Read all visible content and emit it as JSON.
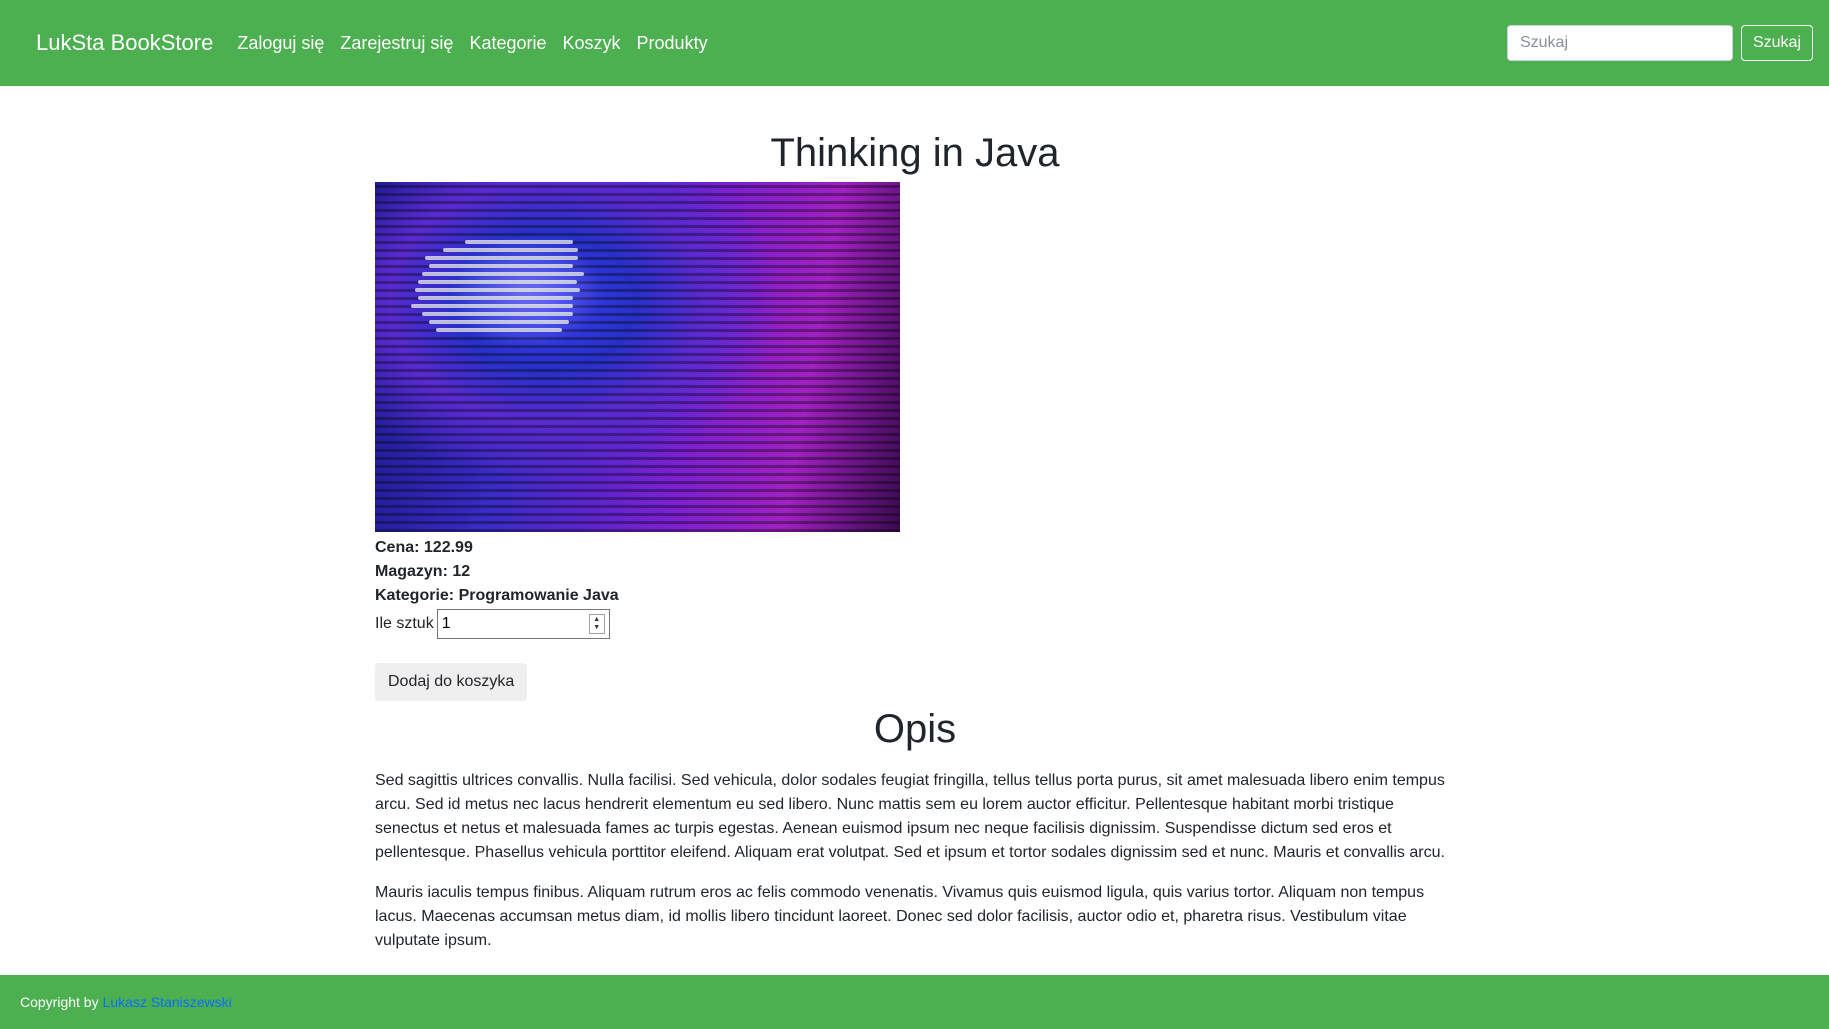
{
  "navbar": {
    "brand": "LukSta BookStore",
    "links": [
      "Zaloguj się",
      "Zarejestruj się",
      "Kategorie",
      "Koszyk",
      "Produkty"
    ],
    "search_placeholder": "Szukaj",
    "search_button": "Szukaj",
    "background_color": "#4caf50"
  },
  "product": {
    "title": "Thinking in Java",
    "price_line": "Cena: 122.99",
    "stock_line": "Magazyn: 12",
    "category_line": "Kategorie: Programowanie Java",
    "quantity_label": "Ile sztuk",
    "quantity_value": "1",
    "add_to_cart": "Dodaj do koszyka"
  },
  "description": {
    "title": "Opis",
    "paragraphs": [
      "Sed sagittis ultrices convallis. Nulla facilisi. Sed vehicula, dolor sodales feugiat fringilla, tellus tellus porta purus, sit amet malesuada libero enim tempus arcu. Sed id metus nec lacus hendrerit elementum eu sed libero. Nunc mattis sem eu lorem auctor efficitur. Pellentesque habitant morbi tristique senectus et netus et malesuada fames ac turpis egestas. Aenean euismod ipsum nec neque facilisis dignissim. Suspendisse dictum sed eros et pellentesque. Phasellus vehicula porttitor eleifend. Aliquam erat volutpat. Sed et ipsum et tortor sodales dignissim sed et nunc. Mauris et convallis arcu.",
      "Mauris iaculis tempus finibus. Aliquam rutrum eros ac felis commodo venenatis. Vivamus quis euismod ligula, quis varius tortor. Aliquam non tempus lacus. Maecenas accumsan metus diam, id mollis libero tincidunt laoreet. Donec sed dolor facilisis, auctor odio et, pharetra risus. Vestibulum vitae vulputate ipsum."
    ]
  },
  "footer": {
    "prefix": "Copyright by",
    "author": "Lukasz Staniszewski",
    "link_color": "#0d6efd"
  }
}
